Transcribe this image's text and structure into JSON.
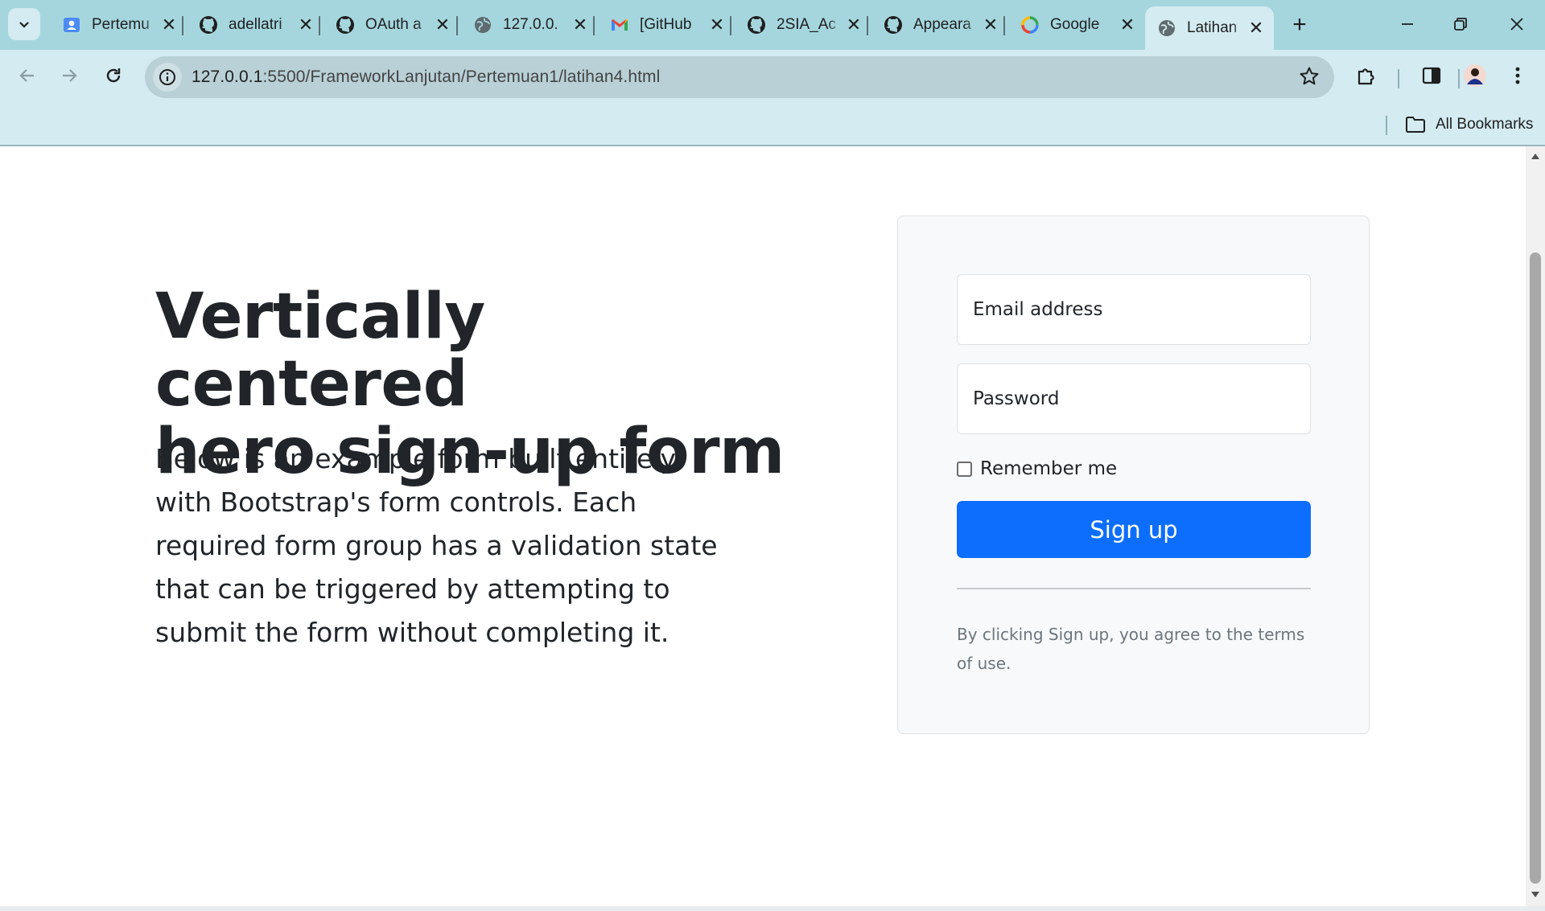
{
  "browser": {
    "tabs": [
      {
        "title": "Pertemu",
        "icon": "contacts-icon"
      },
      {
        "title": "adellatri",
        "icon": "github-icon"
      },
      {
        "title": "OAuth a",
        "icon": "github-icon"
      },
      {
        "title": "127.0.0.",
        "icon": "globe-icon"
      },
      {
        "title": "[GitHub",
        "icon": "gmail-icon"
      },
      {
        "title": "2SIA_Ac",
        "icon": "github-icon"
      },
      {
        "title": "Appeara",
        "icon": "github-icon"
      },
      {
        "title": "Google",
        "icon": "google-icon"
      },
      {
        "title": "Latihan",
        "icon": "globe-icon",
        "active": true
      }
    ],
    "url_host": "127.0.0.1",
    "url_path": ":5500/FrameworkLanjutan/Pertemuan1/latihan4.html",
    "bookmarks_label": "All Bookmarks",
    "colors": {
      "tabstrip": "#a5d6de",
      "toolbar": "#d3ebf1",
      "omnibox": "#b8d0d6"
    }
  },
  "hero": {
    "heading_line1": "Vertically centered",
    "heading_line2": "hero sign-up form",
    "lead": "Below is an example form built entirely with Bootstrap's form controls. Each required form group has a validation state that can be triggered by attempting to submit the form without completing it."
  },
  "form": {
    "email_placeholder": "Email address",
    "password_placeholder": "Password",
    "remember_label": "Remember me",
    "submit_label": "Sign up",
    "terms_text": "By clicking Sign up, you agree to the terms of use.",
    "button_color": "#0d6efd"
  }
}
